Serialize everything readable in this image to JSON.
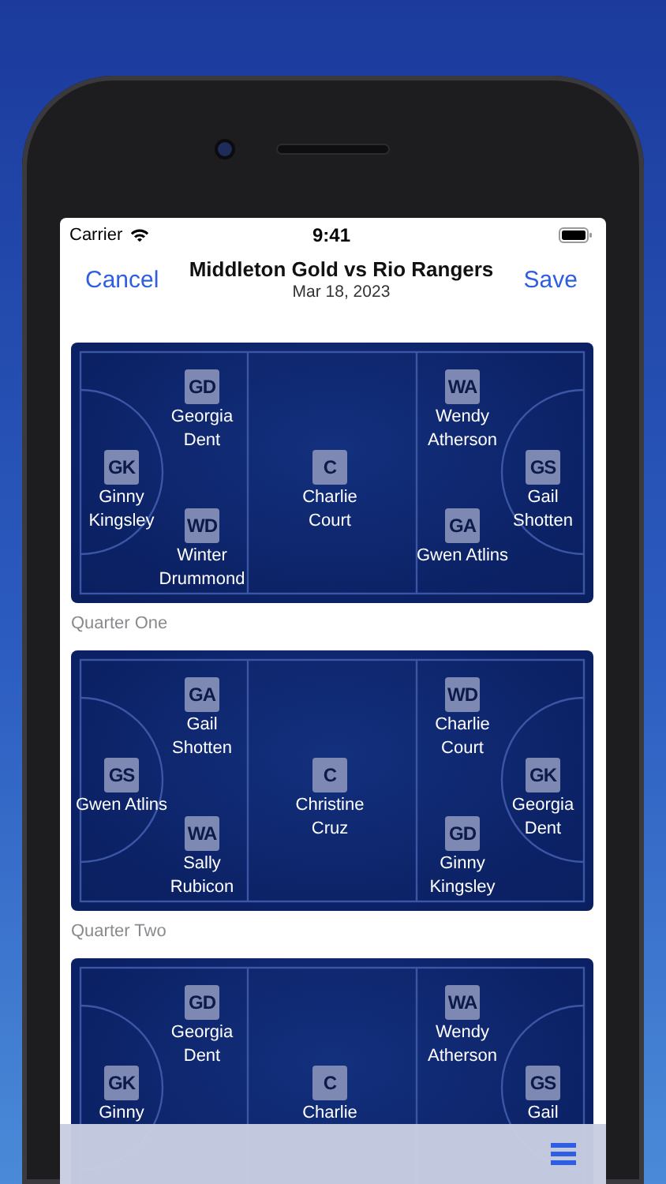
{
  "status_bar": {
    "carrier": "Carrier",
    "time": "9:41"
  },
  "nav": {
    "cancel": "Cancel",
    "title": "Middleton Gold vs Rio Rangers",
    "subtitle": "Mar 18, 2023",
    "save": "Save"
  },
  "quarters": [
    {
      "label": "Quarter One",
      "players": [
        {
          "kind": "west",
          "position": "GK",
          "name": "Ginny Kingsley"
        },
        {
          "kind": "northwest",
          "position": "GD",
          "name": "Georgia Dent"
        },
        {
          "kind": "southwest",
          "position": "WD",
          "name": "Winter Drummond"
        },
        {
          "kind": "centre",
          "position": "C",
          "name": "Charlie Court"
        },
        {
          "kind": "northeast",
          "position": "WA",
          "name": "Wendy Atherson"
        },
        {
          "kind": "southeast",
          "position": "GA",
          "name": "Gwen Atlins"
        },
        {
          "kind": "east",
          "position": "GS",
          "name": "Gail Shotten"
        }
      ]
    },
    {
      "label": "Quarter Two",
      "players": [
        {
          "kind": "west",
          "position": "GS",
          "name": "Gwen Atlins"
        },
        {
          "kind": "northwest",
          "position": "GA",
          "name": "Gail Shotten"
        },
        {
          "kind": "southwest",
          "position": "WA",
          "name": "Sally Rubicon"
        },
        {
          "kind": "centre",
          "position": "C",
          "name": "Christine Cruz"
        },
        {
          "kind": "northeast",
          "position": "WD",
          "name": "Charlie Court"
        },
        {
          "kind": "southeast",
          "position": "GD",
          "name": "Ginny Kingsley"
        },
        {
          "kind": "east",
          "position": "GK",
          "name": "Georgia Dent"
        }
      ]
    },
    {
      "players": [
        {
          "kind": "west",
          "position": "GK",
          "name": "Ginny"
        },
        {
          "kind": "northwest",
          "position": "GD",
          "name": "Georgia Dent"
        },
        {
          "kind": "centre",
          "position": "C",
          "name": "Charlie"
        },
        {
          "kind": "northeast",
          "position": "WA",
          "name": "Wendy Atherson"
        },
        {
          "kind": "east",
          "position": "GS",
          "name": "Gail"
        }
      ]
    }
  ]
}
